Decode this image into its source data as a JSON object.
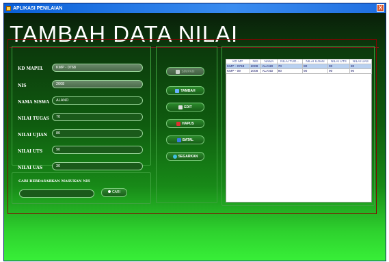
{
  "window": {
    "title": "APLIKASI PENILAIAN",
    "close_label": "X"
  },
  "page": {
    "title": "TAMBAH DATA NILAI"
  },
  "form": {
    "kd_mapel": {
      "label": "KD MAPEL",
      "value": "KMP - 0768"
    },
    "nis": {
      "label": "NIS",
      "value": "2008"
    },
    "nama_siswa": {
      "label": "NAMA SISWA",
      "value": "ALAND"
    },
    "nilai_tugas": {
      "label": "NILAI TUGAS",
      "value": "70"
    },
    "nilai_ujian": {
      "label": "NILAI UJIAN",
      "value": "80"
    },
    "nilai_uts": {
      "label": "NILAI UTS",
      "value": "90"
    },
    "nilai_uas": {
      "label": "NILAI UAS",
      "value": "30"
    }
  },
  "search": {
    "label": "CARI BERDASARKAN MASUKAN NIS",
    "value": "",
    "button_label": "CARI"
  },
  "buttons": {
    "simpan": "SIMPAN",
    "tambah": "TAMBAH",
    "edit": "EDIT",
    "hapus": "HAPUS",
    "batal": "BATAL",
    "segarkan": "SEGARKAN"
  },
  "table": {
    "columns": [
      "KD MP",
      "NIS",
      "NAMA",
      "NILAI TUG...",
      "NILAI UJIAN",
      "NILAI UTS",
      "NILAI UAS"
    ],
    "rows": [
      [
        "KMP - 0768",
        "2008",
        "ALAND",
        "70",
        "80",
        "90",
        "30"
      ],
      [
        "KMP - 09",
        "2008",
        "ALAND",
        "90",
        "90",
        "90",
        "90"
      ]
    ]
  },
  "colors": {
    "title_bar": "#0a5fd8",
    "background_top": "#0a1f0a",
    "background_bottom": "#38f038",
    "accent_border": "#8a0000",
    "panel_border": "#3ea23e"
  },
  "icons": {
    "tambah": "plus-icon",
    "edit": "pencil-icon",
    "hapus": "delete-icon",
    "batal": "undo-icon",
    "segarkan": "refresh-icon",
    "cari": "search-icon",
    "simpan": "save-icon"
  }
}
